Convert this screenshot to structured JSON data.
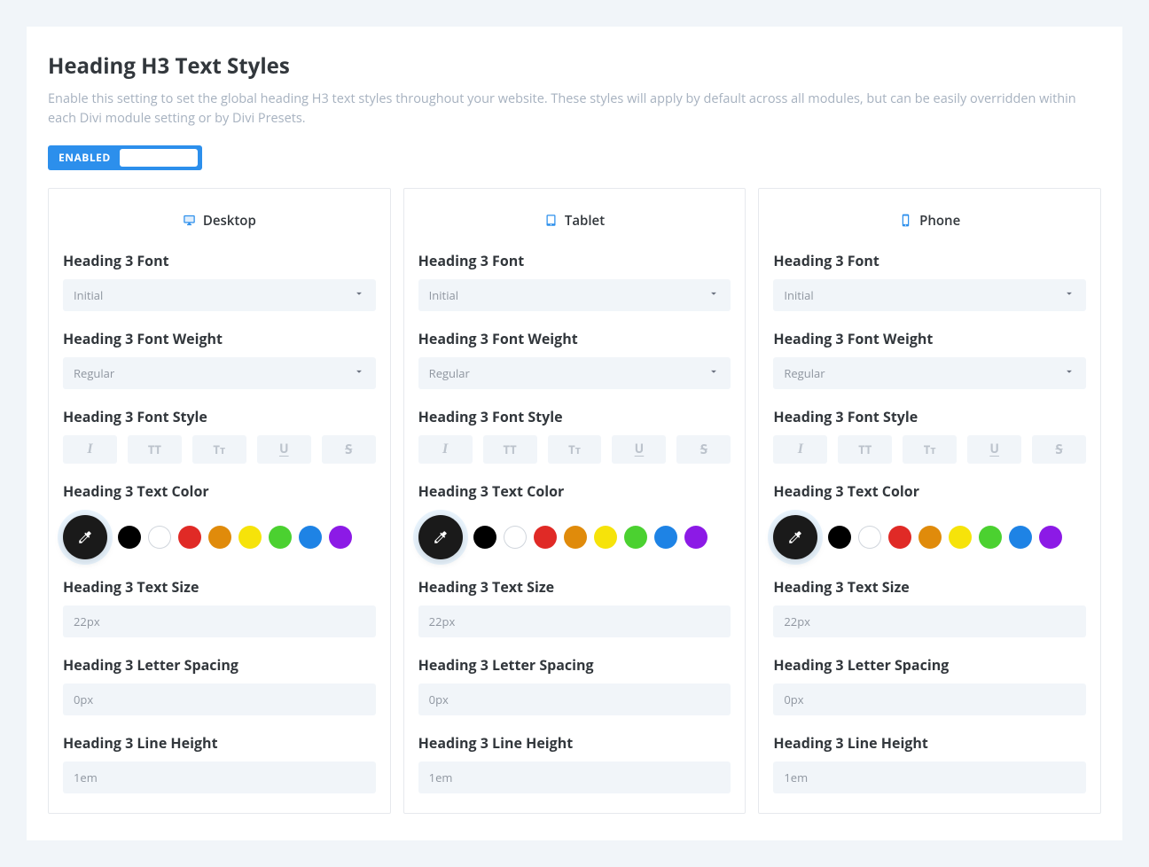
{
  "page": {
    "title": "Heading H3 Text Styles",
    "description": "Enable this setting to set the global heading H3 text styles throughout your website. These styles will apply by default across all modules, but can be easily overridden within each Divi module setting or by Divi Presets.",
    "toggle_label": "ENABLED"
  },
  "labels": {
    "font": "Heading 3 Font",
    "weight": "Heading 3 Font Weight",
    "style": "Heading 3 Font Style",
    "color": "Heading 3 Text Color",
    "size": "Heading 3 Text Size",
    "spacing": "Heading 3 Letter Spacing",
    "lineheight": "Heading 3 Line Height"
  },
  "style_buttons": {
    "italic": "I",
    "uppercase": "TT",
    "smallcaps": "Tᴛ",
    "underline": "U",
    "strike": "S"
  },
  "swatches": [
    "#000000",
    "#ffffff",
    "#e02a26",
    "#e08b0b",
    "#f6e30a",
    "#4bd130",
    "#1e83e5",
    "#8c1ae6"
  ],
  "columns": [
    {
      "id": "desktop",
      "title": "Desktop",
      "icon": "desktop",
      "font": "Initial",
      "weight": "Regular",
      "size": "22px",
      "spacing": "0px",
      "lineheight": "1em"
    },
    {
      "id": "tablet",
      "title": "Tablet",
      "icon": "tablet",
      "font": "Initial",
      "weight": "Regular",
      "size": "22px",
      "spacing": "0px",
      "lineheight": "1em"
    },
    {
      "id": "phone",
      "title": "Phone",
      "icon": "phone",
      "font": "Initial",
      "weight": "Regular",
      "size": "22px",
      "spacing": "0px",
      "lineheight": "1em"
    }
  ]
}
